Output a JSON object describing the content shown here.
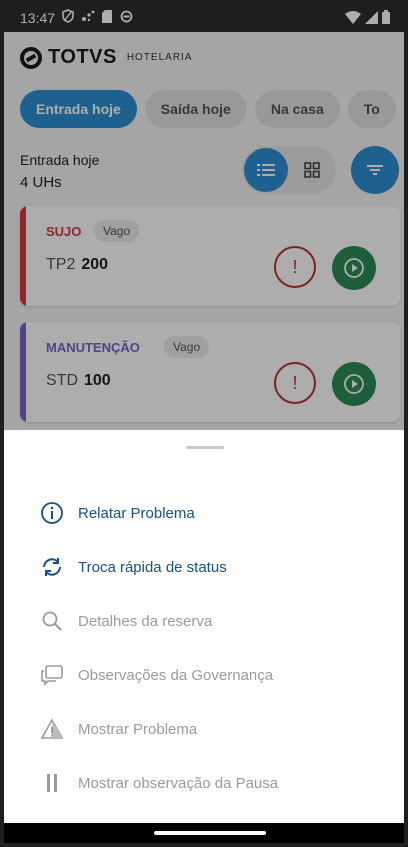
{
  "status_bar": {
    "time": "13:47",
    "left_icons": [
      "vpn-shield-icon",
      "signal-dots-icon",
      "sim-card-icon",
      "sync-icon"
    ],
    "right_icons": [
      "wifi-icon",
      "cell-signal-icon",
      "battery-icon"
    ]
  },
  "header": {
    "logo_text": "TOTVS",
    "logo_sub": "HOTELARIA"
  },
  "tabs": [
    {
      "label": "Entrada hoje",
      "active": true
    },
    {
      "label": "Saída hoje",
      "active": false
    },
    {
      "label": "Na casa",
      "active": false
    },
    {
      "label": "To",
      "active": false
    }
  ],
  "summary": {
    "label": "Entrada hoje",
    "count": "4 UHs"
  },
  "rooms": [
    {
      "status": "SUJO",
      "occupancy": "Vago",
      "type": "TP2",
      "number": "200",
      "status_color": "#d9363e"
    },
    {
      "status": "MANUTENÇÃO",
      "occupancy": "Vago",
      "type": "STD",
      "number": "100",
      "status_color": "#7b63c6"
    }
  ],
  "menu": [
    {
      "label": "Relatar Problema",
      "icon": "info-circle-icon",
      "enabled": true
    },
    {
      "label": "Troca rápida de status",
      "icon": "sync-arrows-icon",
      "enabled": true
    },
    {
      "label": "Detalhes da reserva",
      "icon": "search-icon",
      "enabled": false
    },
    {
      "label": "Observações da Governança",
      "icon": "chat-icon",
      "enabled": false
    },
    {
      "label": "Mostrar Problema",
      "icon": "warning-icon",
      "enabled": false
    },
    {
      "label": "Mostrar observação da Pausa",
      "icon": "pause-icon",
      "enabled": false
    }
  ],
  "colors": {
    "primary": "#2f8fd1",
    "link": "#1a4f8a",
    "disabled": "#9a9a9a",
    "play": "#2e8b56",
    "warning": "#b03636"
  }
}
